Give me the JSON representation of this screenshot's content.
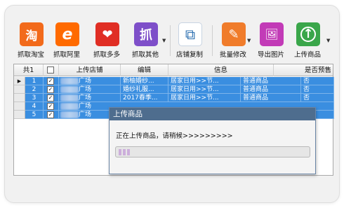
{
  "toolbar": {
    "buttons": [
      {
        "label": "抓取淘宝",
        "icon": "taobao-icon",
        "glyph": "淘",
        "color": "#f26a1b"
      },
      {
        "label": "抓取阿里",
        "icon": "alibaba-icon",
        "glyph": "e",
        "color": "#ffffff"
      },
      {
        "label": "抓取多多",
        "icon": "pinduoduo-icon",
        "glyph": "❤",
        "color": "#e02e24"
      },
      {
        "label": "抓取其他",
        "icon": "grab-icon",
        "glyph": "抓",
        "color": "#7e4fc9"
      },
      {
        "label": "店铺复制",
        "icon": "copy-store-icon",
        "glyph": "⧉",
        "color": "#2b6fb0"
      },
      {
        "label": "批量修改",
        "icon": "batch-edit-icon",
        "glyph": "✎",
        "color": "#f07c2b"
      },
      {
        "label": "导出图片",
        "icon": "export-image-icon",
        "glyph": "🖼",
        "color": "#c23bb7"
      },
      {
        "label": "上传商品",
        "icon": "upload-icon",
        "glyph": "↑",
        "color": "#3aa64a"
      }
    ]
  },
  "grid": {
    "headers": {
      "count": "共1",
      "store": "上传店铺",
      "edit": "编辑",
      "info": "信息",
      "presale": "是否预售"
    },
    "rows": [
      {
        "index": "1",
        "store": "广场",
        "title": "新柚婚纱...",
        "category": "居家日用>>节...",
        "type": "普通商品",
        "presale": "否",
        "checked": "✓",
        "current": true
      },
      {
        "index": "2",
        "store": "广场",
        "title": "婚纱礼服...",
        "category": "居家日用>>节...",
        "type": "普通商品",
        "presale": "否",
        "checked": "✓",
        "current": false
      },
      {
        "index": "3",
        "store": "广场",
        "title": "2017春季...",
        "category": "居家日用>>节...",
        "type": "普通商品",
        "presale": "否",
        "checked": "✓",
        "current": false
      },
      {
        "index": "4",
        "store": "广场",
        "title": "",
        "category": "",
        "type": "",
        "presale": "",
        "checked": "✓",
        "current": false
      },
      {
        "index": "5",
        "store": "广场",
        "title": "",
        "category": "",
        "type": "",
        "presale": "",
        "checked": "✓",
        "current": false
      }
    ]
  },
  "dialog": {
    "title": "上传商品",
    "message": "正在上传商品，请稍候>>>>>>>>>",
    "progress": 0.08
  }
}
